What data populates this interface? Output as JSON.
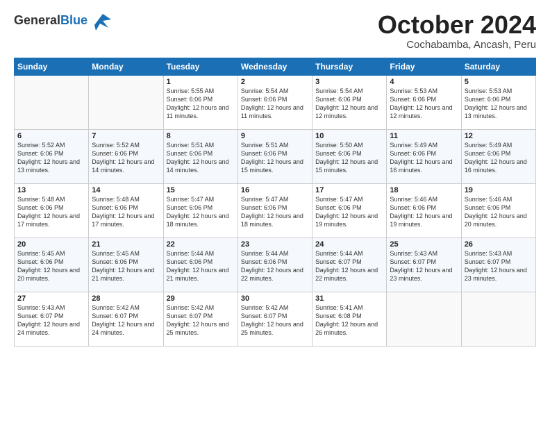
{
  "logo": {
    "general": "General",
    "blue": "Blue"
  },
  "header": {
    "month": "October 2024",
    "location": "Cochabamba, Ancash, Peru"
  },
  "days_of_week": [
    "Sunday",
    "Monday",
    "Tuesday",
    "Wednesday",
    "Thursday",
    "Friday",
    "Saturday"
  ],
  "weeks": [
    [
      {
        "day": "",
        "info": ""
      },
      {
        "day": "",
        "info": ""
      },
      {
        "day": "1",
        "info": "Sunrise: 5:55 AM\nSunset: 6:06 PM\nDaylight: 12 hours and 11 minutes."
      },
      {
        "day": "2",
        "info": "Sunrise: 5:54 AM\nSunset: 6:06 PM\nDaylight: 12 hours and 11 minutes."
      },
      {
        "day": "3",
        "info": "Sunrise: 5:54 AM\nSunset: 6:06 PM\nDaylight: 12 hours and 12 minutes."
      },
      {
        "day": "4",
        "info": "Sunrise: 5:53 AM\nSunset: 6:06 PM\nDaylight: 12 hours and 12 minutes."
      },
      {
        "day": "5",
        "info": "Sunrise: 5:53 AM\nSunset: 6:06 PM\nDaylight: 12 hours and 13 minutes."
      }
    ],
    [
      {
        "day": "6",
        "info": "Sunrise: 5:52 AM\nSunset: 6:06 PM\nDaylight: 12 hours and 13 minutes."
      },
      {
        "day": "7",
        "info": "Sunrise: 5:52 AM\nSunset: 6:06 PM\nDaylight: 12 hours and 14 minutes."
      },
      {
        "day": "8",
        "info": "Sunrise: 5:51 AM\nSunset: 6:06 PM\nDaylight: 12 hours and 14 minutes."
      },
      {
        "day": "9",
        "info": "Sunrise: 5:51 AM\nSunset: 6:06 PM\nDaylight: 12 hours and 15 minutes."
      },
      {
        "day": "10",
        "info": "Sunrise: 5:50 AM\nSunset: 6:06 PM\nDaylight: 12 hours and 15 minutes."
      },
      {
        "day": "11",
        "info": "Sunrise: 5:49 AM\nSunset: 6:06 PM\nDaylight: 12 hours and 16 minutes."
      },
      {
        "day": "12",
        "info": "Sunrise: 5:49 AM\nSunset: 6:06 PM\nDaylight: 12 hours and 16 minutes."
      }
    ],
    [
      {
        "day": "13",
        "info": "Sunrise: 5:48 AM\nSunset: 6:06 PM\nDaylight: 12 hours and 17 minutes."
      },
      {
        "day": "14",
        "info": "Sunrise: 5:48 AM\nSunset: 6:06 PM\nDaylight: 12 hours and 17 minutes."
      },
      {
        "day": "15",
        "info": "Sunrise: 5:47 AM\nSunset: 6:06 PM\nDaylight: 12 hours and 18 minutes."
      },
      {
        "day": "16",
        "info": "Sunrise: 5:47 AM\nSunset: 6:06 PM\nDaylight: 12 hours and 18 minutes."
      },
      {
        "day": "17",
        "info": "Sunrise: 5:47 AM\nSunset: 6:06 PM\nDaylight: 12 hours and 19 minutes."
      },
      {
        "day": "18",
        "info": "Sunrise: 5:46 AM\nSunset: 6:06 PM\nDaylight: 12 hours and 19 minutes."
      },
      {
        "day": "19",
        "info": "Sunrise: 5:46 AM\nSunset: 6:06 PM\nDaylight: 12 hours and 20 minutes."
      }
    ],
    [
      {
        "day": "20",
        "info": "Sunrise: 5:45 AM\nSunset: 6:06 PM\nDaylight: 12 hours and 20 minutes."
      },
      {
        "day": "21",
        "info": "Sunrise: 5:45 AM\nSunset: 6:06 PM\nDaylight: 12 hours and 21 minutes."
      },
      {
        "day": "22",
        "info": "Sunrise: 5:44 AM\nSunset: 6:06 PM\nDaylight: 12 hours and 21 minutes."
      },
      {
        "day": "23",
        "info": "Sunrise: 5:44 AM\nSunset: 6:06 PM\nDaylight: 12 hours and 22 minutes."
      },
      {
        "day": "24",
        "info": "Sunrise: 5:44 AM\nSunset: 6:07 PM\nDaylight: 12 hours and 22 minutes."
      },
      {
        "day": "25",
        "info": "Sunrise: 5:43 AM\nSunset: 6:07 PM\nDaylight: 12 hours and 23 minutes."
      },
      {
        "day": "26",
        "info": "Sunrise: 5:43 AM\nSunset: 6:07 PM\nDaylight: 12 hours and 23 minutes."
      }
    ],
    [
      {
        "day": "27",
        "info": "Sunrise: 5:43 AM\nSunset: 6:07 PM\nDaylight: 12 hours and 24 minutes."
      },
      {
        "day": "28",
        "info": "Sunrise: 5:42 AM\nSunset: 6:07 PM\nDaylight: 12 hours and 24 minutes."
      },
      {
        "day": "29",
        "info": "Sunrise: 5:42 AM\nSunset: 6:07 PM\nDaylight: 12 hours and 25 minutes."
      },
      {
        "day": "30",
        "info": "Sunrise: 5:42 AM\nSunset: 6:07 PM\nDaylight: 12 hours and 25 minutes."
      },
      {
        "day": "31",
        "info": "Sunrise: 5:41 AM\nSunset: 6:08 PM\nDaylight: 12 hours and 26 minutes."
      },
      {
        "day": "",
        "info": ""
      },
      {
        "day": "",
        "info": ""
      }
    ]
  ]
}
